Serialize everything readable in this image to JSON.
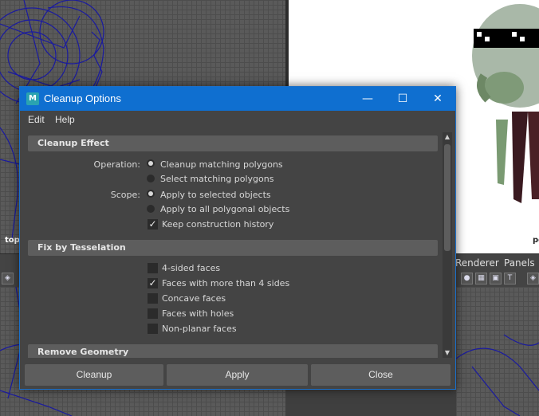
{
  "viewports": {
    "top_label": "top",
    "persp_label": "pe",
    "panel_menus": [
      "Renderer",
      "Panels"
    ]
  },
  "dialog": {
    "title": "Cleanup Options",
    "window_controls": {
      "minimize": "—",
      "maximize": "☐",
      "close": "✕"
    },
    "menu": [
      "Edit",
      "Help"
    ],
    "sections": {
      "cleanup_effect": {
        "title": "Cleanup Effect",
        "operation_label": "Operation:",
        "operation_options": [
          "Cleanup matching polygons",
          "Select matching polygons"
        ],
        "operation_selected": 0,
        "scope_label": "Scope:",
        "scope_options": [
          "Apply to selected objects",
          "Apply to all polygonal objects"
        ],
        "scope_selected": 0,
        "keep_history_label": "Keep construction history",
        "keep_history_checked": true
      },
      "fix_by_tesselation": {
        "title": "Fix by Tesselation",
        "options": [
          {
            "label": "4-sided faces",
            "checked": false
          },
          {
            "label": "Faces with more than 4 sides",
            "checked": true
          },
          {
            "label": "Concave faces",
            "checked": false
          },
          {
            "label": "Faces with holes",
            "checked": false
          },
          {
            "label": "Non-planar faces",
            "checked": false
          }
        ]
      },
      "remove_geometry": {
        "title": "Remove Geometry"
      }
    },
    "buttons": {
      "cleanup": "Cleanup",
      "apply": "Apply",
      "close": "Close"
    }
  },
  "colors": {
    "titlebar": "#0f6fd0",
    "dialog_bg": "#444444",
    "section_bg": "#5d5d5d"
  }
}
